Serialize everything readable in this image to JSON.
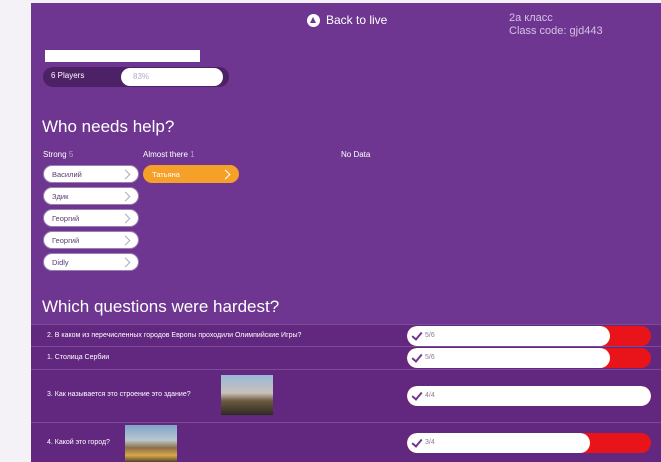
{
  "header": {
    "back_label": "Back to live",
    "class_name": "2a класс",
    "class_code": "Class code: gjd443"
  },
  "players": {
    "label": "6 Players",
    "percent_text": "83%",
    "percent": 83
  },
  "help": {
    "title": "Who needs help?",
    "columns": [
      {
        "label": "Strong",
        "count": "5"
      },
      {
        "label": "Almost there",
        "count": "1"
      },
      {
        "label": "No Data",
        "count": ""
      }
    ],
    "strong": [
      "Василий",
      "Здик",
      "Георгий",
      "Георгий",
      "Didly"
    ],
    "almost_there": [
      "Татьяна"
    ]
  },
  "hardest": {
    "title": "Which questions were hardest?",
    "questions": [
      {
        "text": "2. В каком из перечисленных городов Европы проходили Олимпийские Игры?",
        "score": "5/6",
        "correct": 5,
        "total": 6,
        "has_image": false
      },
      {
        "text": "1. Столица Сербии",
        "score": "5/6",
        "correct": 5,
        "total": 6,
        "has_image": false
      },
      {
        "text": "3. Как называется это строение это здание?",
        "score": "4/4",
        "correct": 4,
        "total": 4,
        "has_image": true,
        "image_icon": "castle-photo"
      },
      {
        "text": "4. Какой это город?",
        "score": "3/4",
        "correct": 3,
        "total": 4,
        "has_image": true,
        "image_icon": "city-photo"
      }
    ]
  },
  "colors": {
    "background": "#6e3690",
    "accent_orange": "#f5a028",
    "wrong_red": "#e8141a"
  }
}
